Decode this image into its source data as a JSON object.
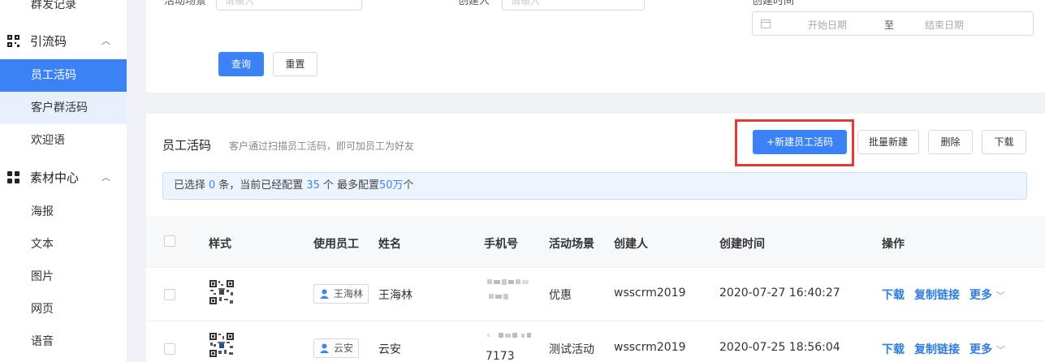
{
  "sidebar": {
    "top_item": "群发记录",
    "group1": {
      "label": "引流码",
      "items": [
        "员工活码",
        "客户群活码",
        "欢迎语"
      ]
    },
    "group2": {
      "label": "素材中心",
      "items": [
        "海报",
        "文本",
        "图片",
        "网页",
        "语音"
      ]
    }
  },
  "filter": {
    "scene_label": "活动场景",
    "scene_placeholder": "请输入",
    "creator_label": "创建人",
    "creator_placeholder": "请输入",
    "time_label": "创建时间",
    "start_date": "开始日期",
    "date_sep": "至",
    "end_date": "结束日期",
    "query_label": "查询",
    "reset_label": "重置"
  },
  "list": {
    "title": "员工活码",
    "description": "客户通过扫描员工活码，即可加员工为好友",
    "new_button": "+新建员工活码",
    "batch_button": "批量新建",
    "delete_button": "删除",
    "download_button": "下载",
    "alert": {
      "prefix": "已选择",
      "selected": "0",
      "mid1": "条，当前已经配置",
      "configured": "35",
      "mid2": "个 最多配置",
      "max": "50万",
      "suffix": "个"
    },
    "columns": [
      "样式",
      "使用员工",
      "姓名",
      "手机号",
      "活动场景",
      "创建人",
      "创建时间",
      "操作"
    ],
    "rows": [
      {
        "employee": "王海林",
        "name": "王海林",
        "phone": "",
        "scene": "优惠",
        "creator": "wsscrm2019",
        "created": "2020-07-27 16:40:27"
      },
      {
        "employee": "云安",
        "name": "云安",
        "phone": "7173",
        "scene": "测试活动",
        "creator": "wsscrm2019",
        "created": "2020-07-25 18:56:04"
      }
    ],
    "ops": {
      "download": "下载",
      "copy": "复制链接",
      "more": "更多"
    }
  },
  "colors": {
    "primary": "#3b82f6",
    "highlight": "#e53935"
  }
}
